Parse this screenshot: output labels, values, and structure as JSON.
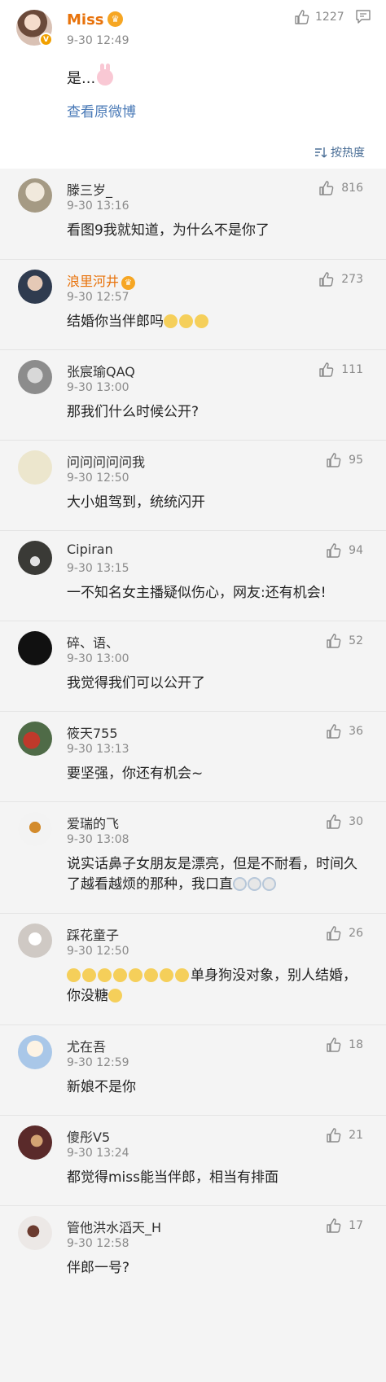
{
  "post": {
    "author": "Miss",
    "time": "9-30 12:49",
    "likes": "1227",
    "text": "是...",
    "view_original": "查看原微博",
    "sort_label": "按热度"
  },
  "comments": [
    {
      "name": "滕三岁_",
      "time": "9-30 13:16",
      "likes": "816",
      "text": "看图9我就知道，为什么不是你了",
      "gold": false,
      "avatar_color": "#d8d3c8"
    },
    {
      "name": "浪里河井",
      "time": "9-30 12:57",
      "likes": "273",
      "text": "结婚你当伴郎吗",
      "gold": true,
      "avatar_color": "#2f3b4f"
    },
    {
      "name": "张宸瑜QAQ",
      "time": "9-30 13:00",
      "likes": "111",
      "text": "那我们什么时候公开?",
      "gold": false,
      "avatar_color": "#9a9a9a"
    },
    {
      "name": "问问问问问我",
      "time": "9-30 12:50",
      "likes": "95",
      "text": "大小姐驾到，统统闪开",
      "gold": false,
      "avatar_color": "#e7e1c9"
    },
    {
      "name": "Cipiran",
      "time": "9-30 13:15",
      "likes": "94",
      "text": "一不知名女主播疑似伤心，网友:还有机会!",
      "gold": false,
      "avatar_color": "#3a3a36"
    },
    {
      "name": "碎、语、",
      "time": "9-30 13:00",
      "likes": "52",
      "text": "我觉得我们可以公开了",
      "gold": false,
      "avatar_color": "#111111"
    },
    {
      "name": "筱天755",
      "time": "9-30 13:13",
      "likes": "36",
      "text": "要坚强，你还有机会~",
      "gold": false,
      "avatar_color": "#b24b3b"
    },
    {
      "name": "爱瑞的飞",
      "time": "9-30 13:08",
      "likes": "30",
      "text": "说实话鼻子女朋友是漂亮，但是不耐看，时间久了越看越烦的那种，我口直",
      "gold": false,
      "avatar_color": "#f3f3f3"
    },
    {
      "name": "踩花童子",
      "time": "9-30 12:50",
      "likes": "26",
      "text": "单身狗没对象，别人结婚，你没糖",
      "gold": false,
      "avatar_color": "#e5e2df"
    },
    {
      "name": "尤在吾",
      "time": "9-30 12:59",
      "likes": "18",
      "text": "新娘不是你",
      "gold": false,
      "avatar_color": "#a9c7e8"
    },
    {
      "name": "傻彤V5",
      "time": "9-30 13:24",
      "likes": "21",
      "text": "都觉得miss能当伴郎，相当有排面",
      "gold": false,
      "avatar_color": "#5a2a2a"
    },
    {
      "name": "管他洪水滔天_H",
      "time": "9-30 12:58",
      "likes": "17",
      "text": "伴郎一号?",
      "gold": false,
      "avatar_color": "#ece8e6"
    }
  ]
}
